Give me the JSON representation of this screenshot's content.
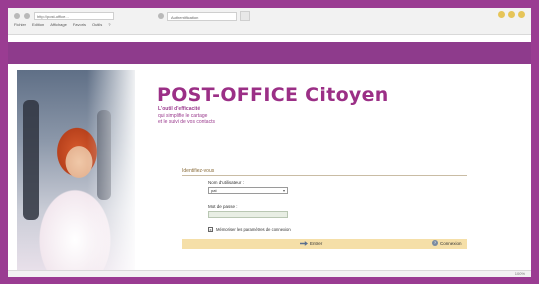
{
  "browser": {
    "url": "http://post-office...",
    "tab_title": "Authentification",
    "menu": [
      "Fichier",
      "Edition",
      "Affichage",
      "Favoris",
      "Outils",
      "?"
    ],
    "zoom": "100%"
  },
  "page": {
    "title": "POST-OFFICE Citoyen",
    "tagline": [
      "L'outil d'efficacité",
      "qui simplifie le cartage",
      "et le suivi de vos contacts"
    ]
  },
  "login": {
    "section_title": "Identifiez-vous",
    "username_label": "Nom d'utilisateur :",
    "username_value": "pat",
    "password_label": "Mot de passe :",
    "remember_label": "Mémoriser les paramètres de connexion",
    "remember_checked": "x",
    "login_button": "Entrer",
    "help_button": "Connexion"
  }
}
